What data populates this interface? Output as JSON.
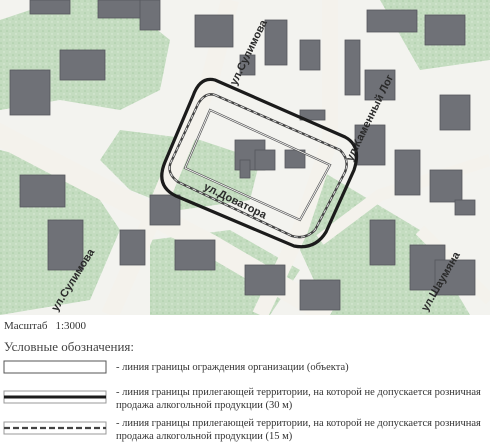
{
  "map": {
    "streets": [
      "ул.Сулимова",
      "ул.Каменный Лог",
      "ул.Доватора",
      "ул.Сулимова",
      "ул.Шаумяна"
    ]
  },
  "scale": {
    "label": "Масштаб",
    "value": "1:3000"
  },
  "legend": {
    "title": "Условные обозначения:",
    "items": [
      {
        "symbol": "fence-boundary-line",
        "text": "- линия границы ограждения организации (объекта)"
      },
      {
        "symbol": "territory-boundary-30m-line",
        "text": "- линия границы прилегающей территории, на которой не допускается розничная продажа алкогольной продукции (30 м)"
      },
      {
        "symbol": "territory-boundary-15m-line",
        "text": "- линия границы прилегающей территории, на которой не допускается розничная продажа алкогольной продукции (15 м)"
      }
    ]
  },
  "colors": {
    "building": "#6f7177",
    "green_area": "#bcd8b9",
    "road": "#f2f0ea",
    "boundary_30m": "#1b1b1b"
  }
}
